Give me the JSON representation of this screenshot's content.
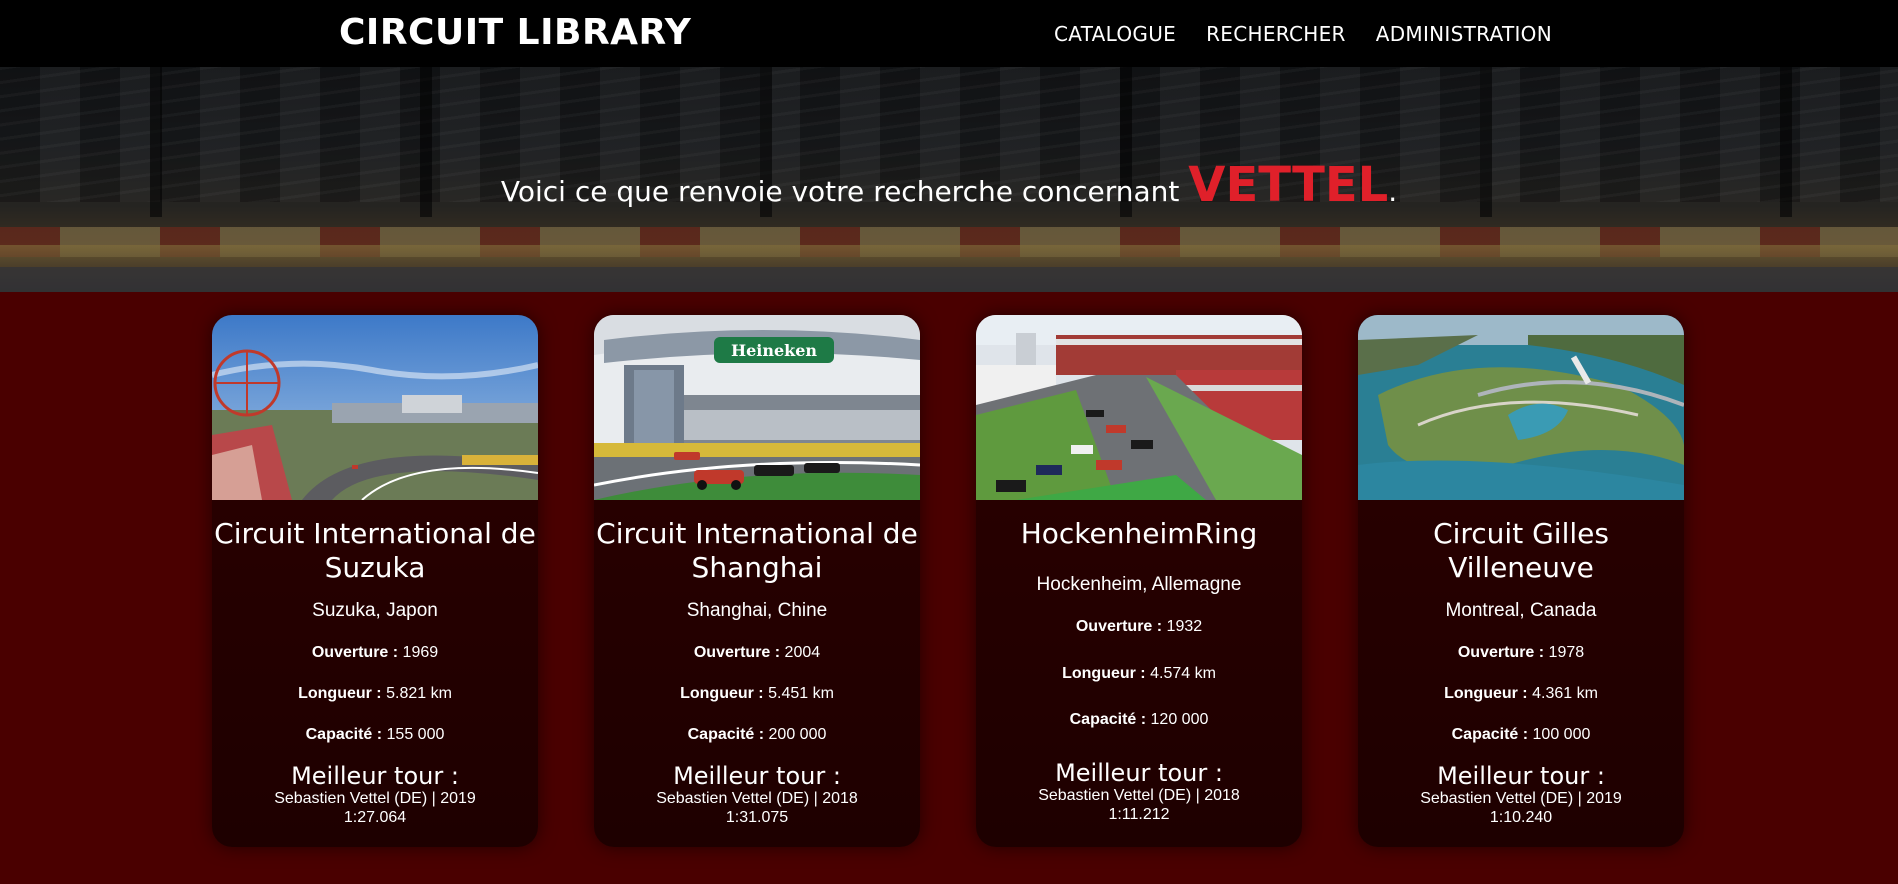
{
  "nav": {
    "brand": "CIRCUIT LIBRARY",
    "links": [
      "CATALOGUE",
      "RECHERCHER",
      "ADMINISTRATION"
    ]
  },
  "hero": {
    "text": "Voici ce que renvoie votre recherche concernant ",
    "query": "VETTEL",
    "suffix": "."
  },
  "labels": {
    "opening": "Ouverture :",
    "length": "Longueur :",
    "capacity": "Capacité :",
    "best_lap": "Meilleur tour :"
  },
  "circuits": [
    {
      "name": "Circuit International de Suzuka",
      "location": "Suzuka, Japon",
      "opening": "1969",
      "length": "5.821 km",
      "capacity": "155 000",
      "best_driver": "Sebastien Vettel (DE) | 2019",
      "best_time": "1:27.064",
      "image": "suzuka-track-photo"
    },
    {
      "name": "Circuit International de Shanghai",
      "location": "Shanghai, Chine",
      "opening": "2004",
      "length": "5.451 km",
      "capacity": "200 000",
      "best_driver": "Sebastien Vettel (DE) | 2018",
      "best_time": "1:31.075",
      "image": "shanghai-grandstand-photo",
      "sign": "Heineken"
    },
    {
      "name": "HockenheimRing",
      "location": "Hockenheim, Allemagne",
      "opening": "1932",
      "length": "4.574 km",
      "capacity": "120 000",
      "best_driver": "Sebastien Vettel (DE) | 2018",
      "best_time": "1:11.212",
      "image": "hockenheim-race-start-photo"
    },
    {
      "name": "Circuit Gilles Villeneuve",
      "location": "Montreal, Canada",
      "opening": "1978",
      "length": "4.361 km",
      "capacity": "100 000",
      "best_driver": "Sebastien Vettel (DE) | 2019",
      "best_time": "1:10.240",
      "image": "montreal-aerial-photo"
    }
  ]
}
